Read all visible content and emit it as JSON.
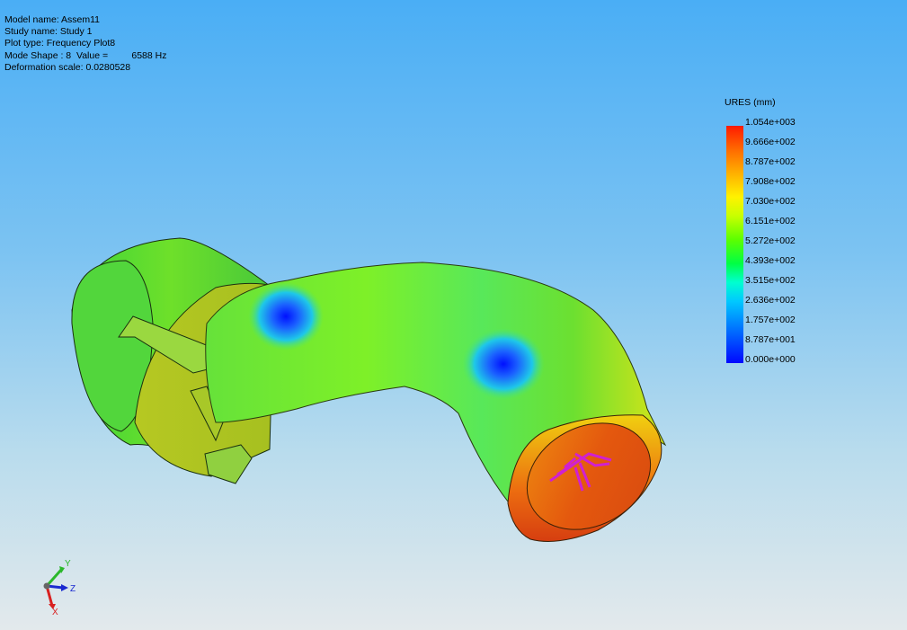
{
  "study_info": {
    "model_name": "Model name: Assem11",
    "study_name": "Study name: Study 1",
    "plot_type": "Plot type: Frequency Plot8",
    "mode_shape": "Mode Shape : 8  Value =         6588 Hz",
    "deformation_scale": "Deformation scale: 0.0280528"
  },
  "legend": {
    "title": "URES (mm)",
    "ticks": [
      "1.054e+003",
      "9.666e+002",
      "8.787e+002",
      "7.908e+002",
      "7.030e+002",
      "6.151e+002",
      "5.272e+002",
      "4.393e+002",
      "3.515e+002",
      "2.636e+002",
      "1.757e+002",
      "8.787e+001",
      "0.000e+000"
    ]
  },
  "triad": {
    "x": "X",
    "y": "Y",
    "z": "Z"
  },
  "colors": {
    "max": "#ff1a00",
    "min": "#0008ff",
    "background_top": "#4aaef5",
    "background_bottom": "#e3e9ec"
  }
}
